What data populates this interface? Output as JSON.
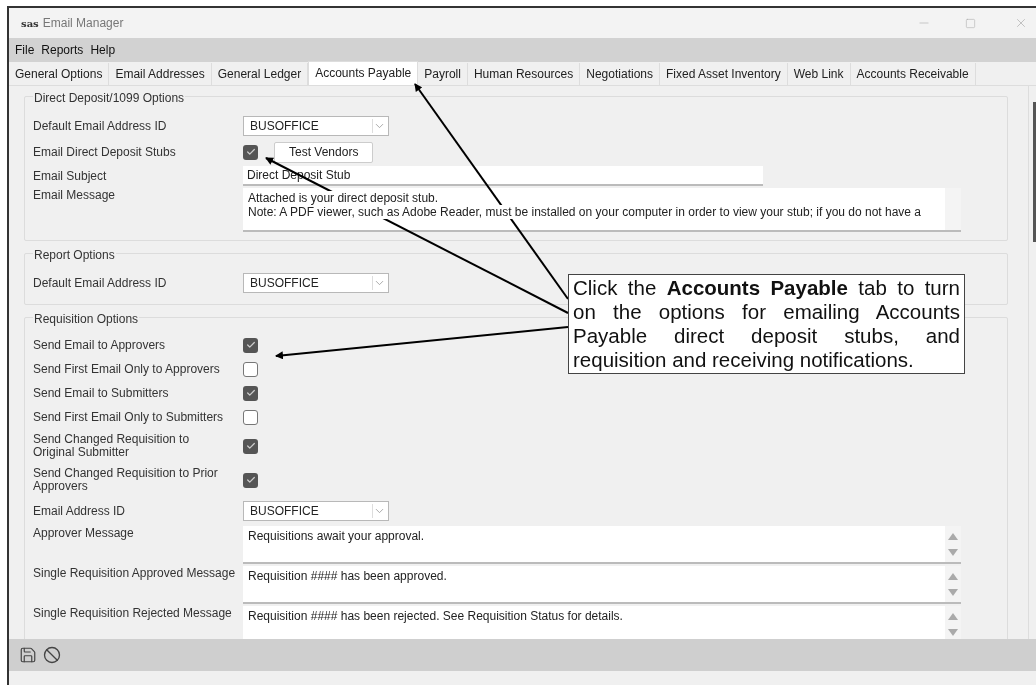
{
  "window": {
    "logo": "sas",
    "title": "Email Manager"
  },
  "menu": [
    "File",
    "Reports",
    "Help"
  ],
  "tabs": [
    {
      "label": "General Options",
      "selected": false
    },
    {
      "label": "Email Addresses",
      "selected": false
    },
    {
      "label": "General Ledger",
      "selected": false
    },
    {
      "label": "Accounts Payable",
      "selected": true
    },
    {
      "label": "Payroll",
      "selected": false
    },
    {
      "label": "Human Resources",
      "selected": false
    },
    {
      "label": "Negotiations",
      "selected": false
    },
    {
      "label": "Fixed Asset Inventory",
      "selected": false
    },
    {
      "label": "Web Link",
      "selected": false
    },
    {
      "label": "Accounts Receivable",
      "selected": false
    }
  ],
  "sections": [
    {
      "legend": "Direct Deposit/1099 Options",
      "fields": [
        {
          "kind": "dropdown",
          "label": "Default Email Address ID",
          "value": "BUSOFFICE"
        },
        {
          "kind": "checkbox",
          "label": "Email Direct Deposit Stubs",
          "checked": true,
          "button": "Test Vendors"
        },
        {
          "kind": "text",
          "label": "Email Subject",
          "value": "Direct Deposit Stub"
        },
        {
          "kind": "memo",
          "label": "Email Message",
          "lines": [
            "Attached is your direct deposit stub.",
            "Note:  A PDF viewer, such as Adobe Reader, must be installed on your computer in order to view your stub; if you do not have a"
          ],
          "arrows": false
        }
      ]
    },
    {
      "legend": "Report Options",
      "fields": [
        {
          "kind": "dropdown",
          "label": "Default Email Address ID",
          "value": "BUSOFFICE"
        }
      ]
    },
    {
      "legend": "Requisition Options",
      "fields": [
        {
          "kind": "checkbox",
          "label": "Send Email to Approvers",
          "checked": true
        },
        {
          "kind": "checkbox",
          "label": "Send First Email Only to Approvers",
          "checked": false
        },
        {
          "kind": "checkbox",
          "label": "Send Email to Submitters",
          "checked": true
        },
        {
          "kind": "checkbox",
          "label": "Send First Email Only to Submitters",
          "checked": false
        },
        {
          "kind": "checkbox",
          "label": "Send Changed Requisition to Original Submitter",
          "checked": true
        },
        {
          "kind": "checkbox",
          "label": "Send Changed Requisition to Prior Approvers",
          "checked": true
        },
        {
          "kind": "dropdown",
          "label": "Email Address ID",
          "value": "BUSOFFICE"
        },
        {
          "kind": "memo",
          "label": "Approver Message",
          "lines": [
            "Requisitions await your approval."
          ],
          "arrows": true
        },
        {
          "kind": "memo",
          "label": "Single Requisition Approved Message",
          "lines": [
            "Requisition #### has been approved."
          ],
          "arrows": true
        },
        {
          "kind": "memo",
          "label": "Single Requisition Rejected Message",
          "lines": [
            "Requisition #### has been rejected.  See Requisition Status for details."
          ],
          "arrows": true
        }
      ]
    }
  ],
  "callout": {
    "text": "Click the **Accounts Payable** tab to turn on the options for emailing Accounts Payable direct deposit stubs, and requisition and receiving notifications."
  }
}
